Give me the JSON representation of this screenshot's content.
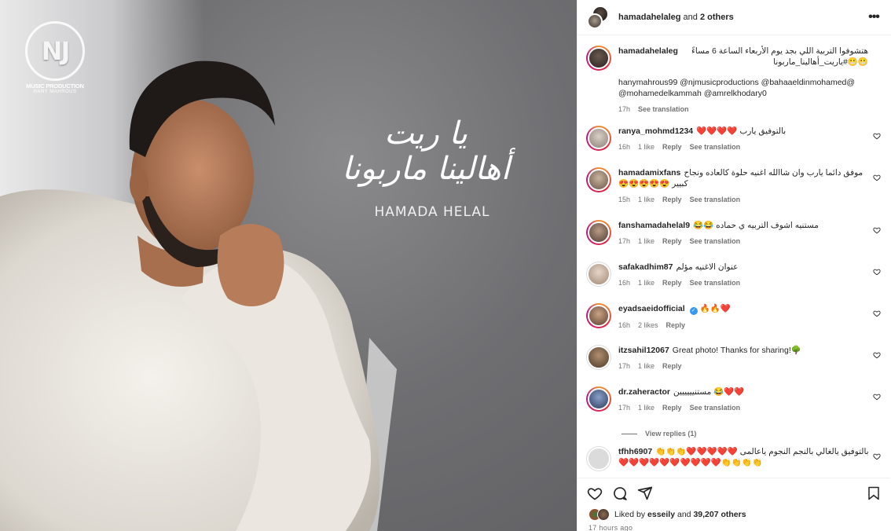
{
  "media": {
    "logo_initials": "NJ",
    "logo_line1": "MUSIC PRODUCTION",
    "logo_line2": "HANY MAHROUS",
    "song_title_line1": "يا ريت",
    "song_title_line2": "أهالينا ماربونا",
    "artist": "HAMADA HELAL"
  },
  "header": {
    "account": "hamadahelaleg",
    "and_text": " and ",
    "others": "2 others",
    "more_icon": "more-horizontal-icon"
  },
  "caption": {
    "username": "hamadahelaleg",
    "text": "هتشوفوا التربية اللي بجد يوم الأربعاء الساعة 6 مساءً 😬😬#ياريت_أهالينا_ماربونا",
    "mentions": "hanymahrous99 @njmusicproductions @bahaaeldinmohamed@ @mohamedelkammah @amrelkhodary0",
    "time": "17h",
    "see_translation": "See translation"
  },
  "comments": [
    {
      "username": "ranya_mohmd1234",
      "text": "بالتوفيق يارب ❤️❤️❤️❤️",
      "time": "16h",
      "likes": "1 like",
      "reply": "Reply",
      "translation": "See translation",
      "verified": false
    },
    {
      "username": "hamadamixfans",
      "text": "موفق دائما يارب وان شاالله اغنيه حلوة كالعاده ونجاح كبيير 😍😍😍😍😍",
      "time": "15h",
      "likes": "1 like",
      "reply": "Reply",
      "translation": "See translation",
      "verified": false
    },
    {
      "username": "fanshamadahelal9",
      "text": "مستنيه اشوف التربيه ي حماده 😂😂",
      "time": "17h",
      "likes": "1 like",
      "reply": "Reply",
      "translation": "See translation",
      "verified": false
    },
    {
      "username": "safakadhim87",
      "text": "عنوان الاغنيه مؤلم",
      "time": "16h",
      "likes": "1 like",
      "reply": "Reply",
      "translation": "See translation",
      "verified": false
    },
    {
      "username": "eyadsaeidofficial",
      "text": "🔥🔥❤️",
      "time": "16h",
      "likes": "2 likes",
      "reply": "Reply",
      "translation": "",
      "verified": true
    },
    {
      "username": "itzsahil12067",
      "text": "Great photo! Thanks for sharing!🌳",
      "time": "17h",
      "likes": "1 like",
      "reply": "Reply",
      "translation": "",
      "verified": false
    },
    {
      "username": "dr.zaheractor",
      "text": "❤️❤️😂 مستنيييييين",
      "time": "17h",
      "likes": "1 like",
      "reply": "Reply",
      "translation": "See translation",
      "verified": false
    },
    {
      "username": "tfhh6907",
      "text": "بالتوفيق يالغالي بالنجم النجوم ياعالمى ❤️❤️❤️❤️❤️👏👏👏👏👏👏👏❤️❤️❤️❤️❤️❤️❤️❤️❤️❤️",
      "time": "",
      "likes": "",
      "reply": "",
      "translation": "",
      "verified": false
    }
  ],
  "view_replies": "View replies (1)",
  "footer": {
    "liked_by": "Liked by ",
    "liker": "esseily",
    "and": " and ",
    "count": "39,207 others",
    "timestamp": "17 hours ago"
  },
  "colors": {
    "text": "#262626",
    "muted": "#737373",
    "link": "#00376b",
    "verified": "#3897f0",
    "border": "#efefef"
  }
}
